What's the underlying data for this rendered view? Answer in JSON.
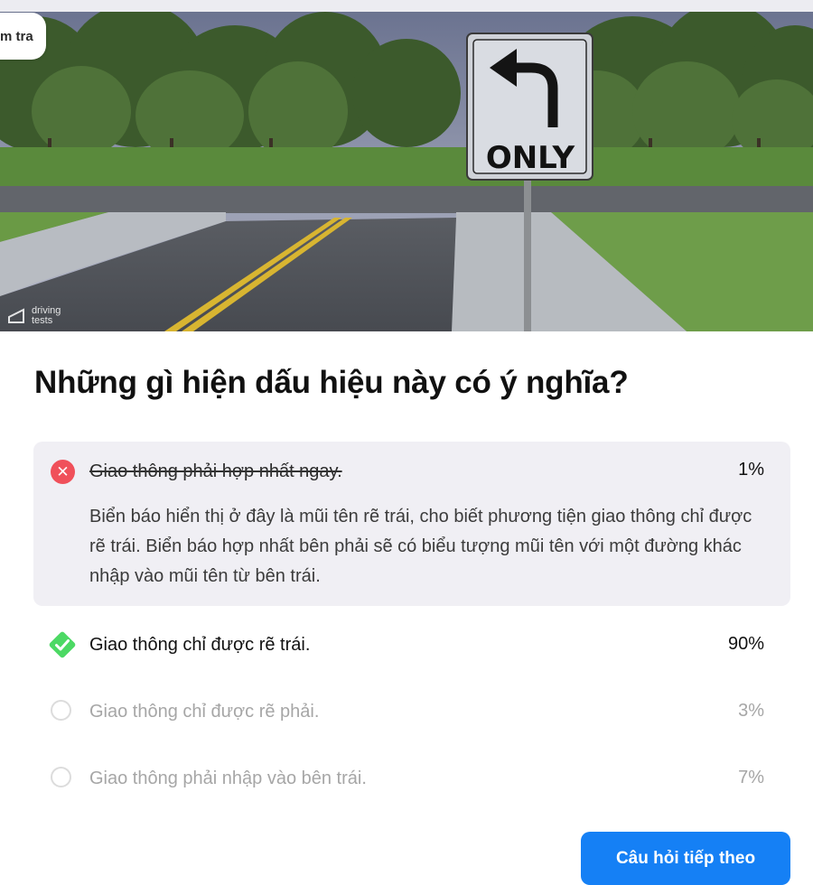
{
  "pill": {
    "text": "m tra"
  },
  "hero": {
    "sign_text": "ONLY",
    "watermark_line1": "driving",
    "watermark_line2": "tests"
  },
  "question": "Những gì hiện dấu hiệu này có ý nghĩa?",
  "answers": [
    {
      "state": "wrong",
      "icon": "x-circle-icon",
      "label": "Giao thông phải hợp nhất ngay.",
      "percent": "1%",
      "explanation": "Biển báo hiển thị ở đây là mũi tên rẽ trái, cho biết phương tiện giao thông chỉ được rẽ trái. Biển báo hợp nhất bên phải sẽ có biểu tượng mũi tên với một đường khác nhập vào mũi tên từ bên trái."
    },
    {
      "state": "correct",
      "icon": "check-diamond-icon",
      "label": "Giao thông chỉ được rẽ trái.",
      "percent": "90%"
    },
    {
      "state": "neutral",
      "icon": "radio-icon",
      "label": "Giao thông chỉ được rẽ phải.",
      "percent": "3%"
    },
    {
      "state": "neutral",
      "icon": "radio-icon",
      "label": "Giao thông phải nhập vào bên trái.",
      "percent": "7%"
    }
  ],
  "next_button": "Câu hỏi tiếp theo",
  "colors": {
    "accent": "#1580f5",
    "wrong": "#f0505a",
    "correct": "#4cd964",
    "feedback_bg": "#f0eff4"
  }
}
